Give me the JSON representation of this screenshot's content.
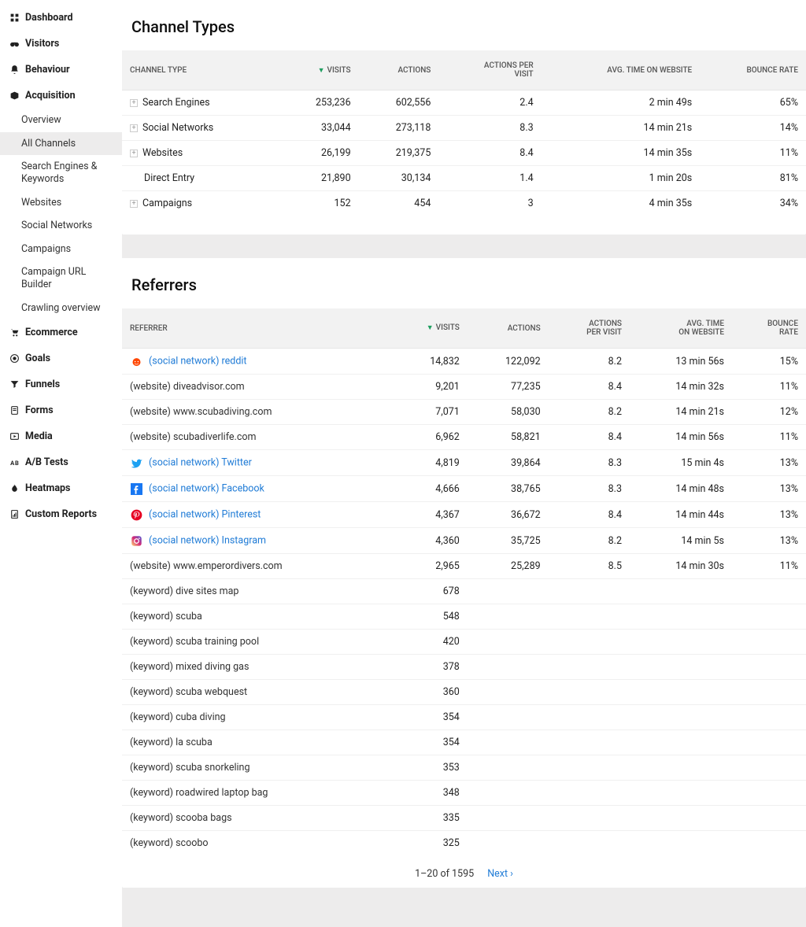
{
  "sidebar": {
    "items": [
      {
        "label": "Dashboard",
        "bold": true,
        "icon": "grid"
      },
      {
        "label": "Visitors",
        "bold": true,
        "icon": "binoculars"
      },
      {
        "label": "Behaviour",
        "bold": true,
        "icon": "bell"
      },
      {
        "label": "Acquisition",
        "bold": true,
        "icon": "box",
        "expanded": true,
        "children": [
          {
            "label": "Overview"
          },
          {
            "label": "All Channels",
            "active": true
          },
          {
            "label": "Search Engines & Keywords"
          },
          {
            "label": "Websites"
          },
          {
            "label": "Social Networks"
          },
          {
            "label": "Campaigns"
          },
          {
            "label": "Campaign URL Builder"
          },
          {
            "label": "Crawling overview"
          }
        ]
      },
      {
        "label": "Ecommerce",
        "bold": true,
        "icon": "cart"
      },
      {
        "label": "Goals",
        "bold": true,
        "icon": "target"
      },
      {
        "label": "Funnels",
        "bold": true,
        "icon": "funnel"
      },
      {
        "label": "Forms",
        "bold": true,
        "icon": "form"
      },
      {
        "label": "Media",
        "bold": true,
        "icon": "media"
      },
      {
        "label": "A/B Tests",
        "bold": true,
        "icon": "ab"
      },
      {
        "label": "Heatmaps",
        "bold": true,
        "icon": "flame"
      },
      {
        "label": "Custom Reports",
        "bold": true,
        "icon": "report"
      }
    ]
  },
  "channel_types": {
    "title": "Channel Types",
    "columns": [
      "CHANNEL TYPE",
      "VISITS",
      "ACTIONS",
      "ACTIONS PER VISIT",
      "AVG. TIME ON WEBSITE",
      "BOUNCE RATE"
    ],
    "sorted_col": "VISITS",
    "rows": [
      {
        "expandable": true,
        "label": "Search Engines",
        "visits": "253,236",
        "actions": "602,556",
        "apv": "2.4",
        "time": "2 min 49s",
        "bounce": "65%"
      },
      {
        "expandable": true,
        "label": "Social Networks",
        "visits": "33,044",
        "actions": "273,118",
        "apv": "8.3",
        "time": "14 min 21s",
        "bounce": "14%"
      },
      {
        "expandable": true,
        "label": "Websites",
        "visits": "26,199",
        "actions": "219,375",
        "apv": "8.4",
        "time": "14 min 35s",
        "bounce": "11%"
      },
      {
        "expandable": false,
        "label": "Direct Entry",
        "visits": "21,890",
        "actions": "30,134",
        "apv": "1.4",
        "time": "1 min 20s",
        "bounce": "81%"
      },
      {
        "expandable": true,
        "label": "Campaigns",
        "visits": "152",
        "actions": "454",
        "apv": "3",
        "time": "4 min 35s",
        "bounce": "34%"
      }
    ]
  },
  "referrers": {
    "title": "Referrers",
    "columns": [
      "REFERRER",
      "VISITS",
      "ACTIONS",
      "ACTIONS PER VISIT",
      "AVG. TIME ON WEBSITE",
      "BOUNCE RATE"
    ],
    "sorted_col": "VISITS",
    "rows": [
      {
        "icon": "reddit",
        "icon_color": "#ff4500",
        "link": true,
        "label": "(social network) reddit",
        "visits": "14,832",
        "actions": "122,092",
        "apv": "8.2",
        "time": "13 min 56s",
        "bounce": "15%"
      },
      {
        "icon": "",
        "link": false,
        "label": "(website) diveadvisor.com",
        "visits": "9,201",
        "actions": "77,235",
        "apv": "8.4",
        "time": "14 min 32s",
        "bounce": "11%"
      },
      {
        "icon": "",
        "link": false,
        "label": "(website) www.scubadiving.com",
        "visits": "7,071",
        "actions": "58,030",
        "apv": "8.2",
        "time": "14 min 21s",
        "bounce": "12%"
      },
      {
        "icon": "",
        "link": false,
        "label": "(website) scubadiverlife.com",
        "visits": "6,962",
        "actions": "58,821",
        "apv": "8.4",
        "time": "14 min 56s",
        "bounce": "11%"
      },
      {
        "icon": "twitter",
        "icon_color": "#1da1f2",
        "link": true,
        "label": "(social network) Twitter",
        "visits": "4,819",
        "actions": "39,864",
        "apv": "8.3",
        "time": "15 min 4s",
        "bounce": "13%"
      },
      {
        "icon": "facebook",
        "icon_color": "#1877f2",
        "link": true,
        "label": "(social network) Facebook",
        "visits": "4,666",
        "actions": "38,765",
        "apv": "8.3",
        "time": "14 min 48s",
        "bounce": "13%"
      },
      {
        "icon": "pinterest",
        "icon_color": "#e60023",
        "link": true,
        "label": "(social network) Pinterest",
        "visits": "4,367",
        "actions": "36,672",
        "apv": "8.4",
        "time": "14 min 44s",
        "bounce": "13%"
      },
      {
        "icon": "instagram",
        "icon_color": "#e1306c",
        "link": true,
        "label": "(social network) Instagram",
        "visits": "4,360",
        "actions": "35,725",
        "apv": "8.2",
        "time": "14 min 5s",
        "bounce": "13%"
      },
      {
        "icon": "",
        "link": false,
        "label": "(website) www.emperordivers.com",
        "visits": "2,965",
        "actions": "25,289",
        "apv": "8.5",
        "time": "14 min 30s",
        "bounce": "11%"
      },
      {
        "icon": "",
        "link": false,
        "label": "(keyword) dive sites map",
        "visits": "678",
        "actions": "",
        "apv": "",
        "time": "",
        "bounce": ""
      },
      {
        "icon": "",
        "link": false,
        "label": "(keyword) scuba",
        "visits": "548",
        "actions": "",
        "apv": "",
        "time": "",
        "bounce": ""
      },
      {
        "icon": "",
        "link": false,
        "label": "(keyword) scuba training pool",
        "visits": "420",
        "actions": "",
        "apv": "",
        "time": "",
        "bounce": ""
      },
      {
        "icon": "",
        "link": false,
        "label": "(keyword) mixed diving gas",
        "visits": "378",
        "actions": "",
        "apv": "",
        "time": "",
        "bounce": ""
      },
      {
        "icon": "",
        "link": false,
        "label": "(keyword) scuba webquest",
        "visits": "360",
        "actions": "",
        "apv": "",
        "time": "",
        "bounce": ""
      },
      {
        "icon": "",
        "link": false,
        "label": "(keyword) cuba diving",
        "visits": "354",
        "actions": "",
        "apv": "",
        "time": "",
        "bounce": ""
      },
      {
        "icon": "",
        "link": false,
        "label": "(keyword) la scuba",
        "visits": "354",
        "actions": "",
        "apv": "",
        "time": "",
        "bounce": ""
      },
      {
        "icon": "",
        "link": false,
        "label": "(keyword) scuba snorkeling",
        "visits": "353",
        "actions": "",
        "apv": "",
        "time": "",
        "bounce": ""
      },
      {
        "icon": "",
        "link": false,
        "label": "(keyword) roadwired laptop bag",
        "visits": "348",
        "actions": "",
        "apv": "",
        "time": "",
        "bounce": ""
      },
      {
        "icon": "",
        "link": false,
        "label": "(keyword) scooba bags",
        "visits": "335",
        "actions": "",
        "apv": "",
        "time": "",
        "bounce": ""
      },
      {
        "icon": "",
        "link": false,
        "label": "(keyword) scoobo",
        "visits": "325",
        "actions": "",
        "apv": "",
        "time": "",
        "bounce": ""
      }
    ],
    "footer": {
      "range": "1–20 of 1595",
      "next": "Next ›"
    }
  },
  "icon_glyphs": {
    "grid": "▦",
    "binoculars": "👓",
    "bell": "🔔",
    "box": "📦",
    "cart": "🛒",
    "target": "◎",
    "funnel": "▾",
    "form": "📋",
    "media": "▶",
    "ab": "⁂",
    "flame": "♨",
    "report": "📑",
    "reddit": "👽",
    "twitter": "🐦",
    "facebook": "f",
    "pinterest": "📍",
    "instagram": "📸"
  }
}
